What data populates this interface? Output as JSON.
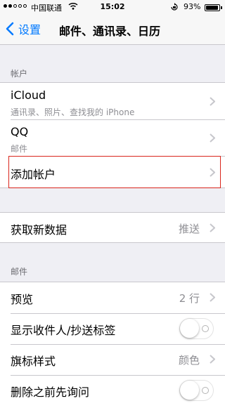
{
  "status_bar": {
    "carrier": "中国联通",
    "time": "15:02",
    "battery_percent": "93%",
    "battery_level": 0.93,
    "signal_dots": [
      true,
      true,
      false,
      false,
      false
    ],
    "icons": [
      "signal-dots-icon",
      "wifi-icon",
      "rotation-lock-icon",
      "battery-icon"
    ]
  },
  "nav": {
    "back_label": "设置",
    "title": "邮件、通讯录、日历"
  },
  "accounts_section": {
    "header": "帐户",
    "items": [
      {
        "label": "iCloud",
        "sub": "通讯录、照片、查找我的 iPhone"
      },
      {
        "label": "QQ",
        "sub": "邮件"
      },
      {
        "label": "添加帐户"
      }
    ]
  },
  "fetch": {
    "label": "获取新数据",
    "value": "推送"
  },
  "mail_section": {
    "header": "邮件",
    "preview": {
      "label": "预览",
      "value": "2 行"
    },
    "show_to_cc": {
      "label": "显示收件人/抄送标签",
      "on": false
    },
    "flag_style": {
      "label": "旗标样式",
      "value": "颜色"
    },
    "ask_before_delete": {
      "label": "删除之前先询问",
      "on": false
    }
  },
  "colors": {
    "accent": "#007aff",
    "background": "#efeff4",
    "highlight": "#d9261c"
  }
}
